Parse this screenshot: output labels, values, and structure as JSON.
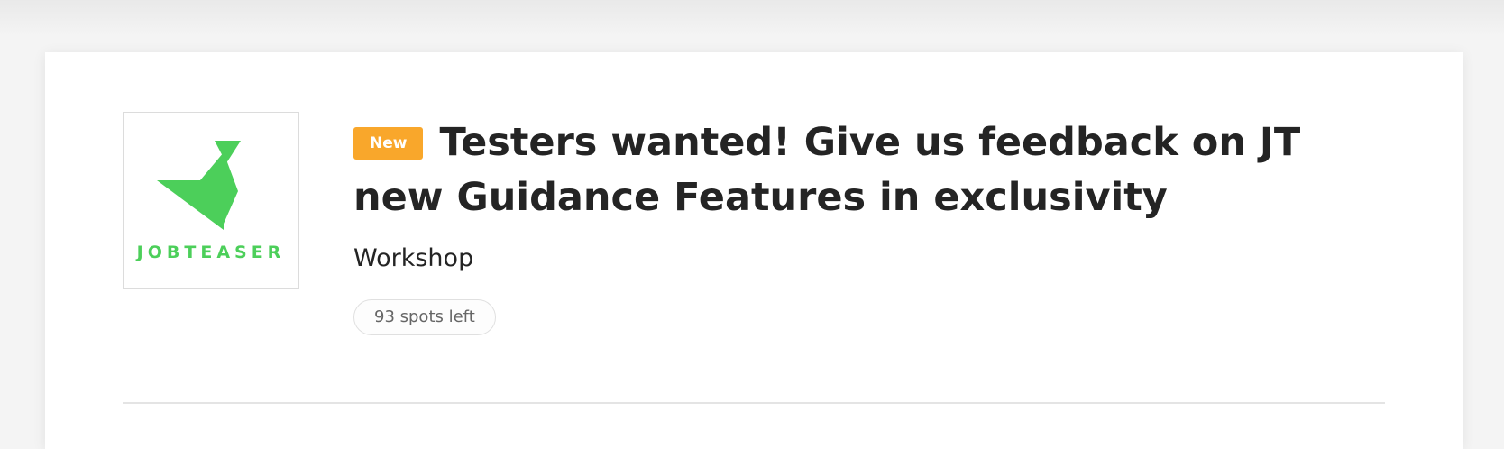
{
  "event": {
    "badge": "New",
    "title": "Testers wanted! Give us feedback on JT new Guidance Features in exclusivity",
    "type": "Workshop",
    "spots": "93 spots left"
  },
  "company": {
    "logo_text": "JOBTEASER",
    "logo_icon": "jobteaser-logo-icon"
  },
  "colors": {
    "badge_bg": "#f9a72b",
    "logo_green": "#4ccf5a",
    "title_text": "#242424"
  }
}
